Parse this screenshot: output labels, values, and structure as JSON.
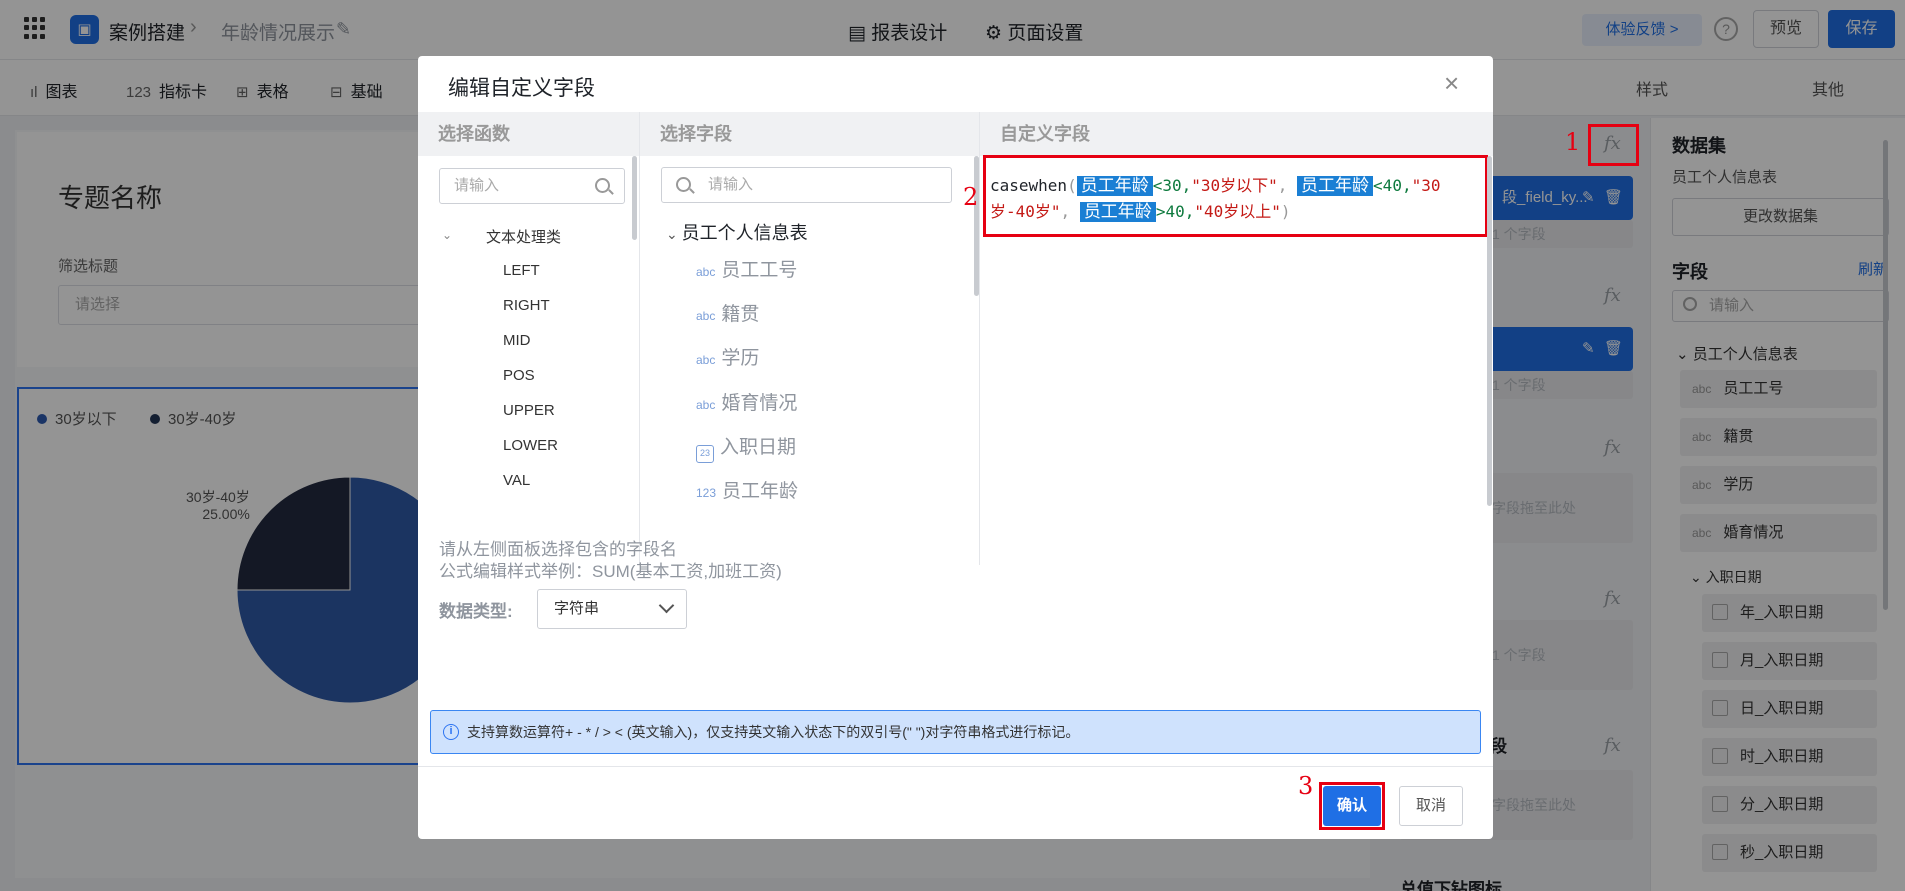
{
  "app": {
    "breadcrumb_project": "案例搭建",
    "breadcrumb_page": "年龄情况展示",
    "tabs": [
      "报表设计",
      "页面设置"
    ],
    "feedback_label": "体验反馈 >",
    "preview_label": "预览",
    "save_label": "保存"
  },
  "toolbar": {
    "items": [
      {
        "icon": "bar-chart-icon",
        "label": "图表"
      },
      {
        "icon": "metric-icon",
        "glyph": "123",
        "label": "指标卡"
      },
      {
        "icon": "table-icon",
        "label": "表格"
      },
      {
        "icon": "basic-icon",
        "label": "基础"
      }
    ],
    "right_tabs": [
      "样式",
      "其他"
    ]
  },
  "canvas": {
    "topic_title": "专题名称",
    "filter_title": "筛选标题",
    "filter_placeholder": "请选择",
    "legend": [
      {
        "label": "30岁以下",
        "color": "#2d5bb0"
      },
      {
        "label": "30岁-40岁",
        "color": "#243657"
      }
    ],
    "pie_label_name": "30岁-40岁",
    "pie_label_pct": "25.00%"
  },
  "chart_data": {
    "type": "pie",
    "categories": [
      "30岁以下",
      "30岁-40岁"
    ],
    "values": [
      75,
      25
    ],
    "colors": [
      "#2f5aa8",
      "#232a40"
    ],
    "labels": [
      "",
      "30岁-40岁 25.00%"
    ],
    "legend_position": "top-left"
  },
  "middle_panel": {
    "chip1_text": "段_field_ky...",
    "hint_one_field": "1 个字段",
    "hint_drag": "字段拖至此处",
    "section_label": "段",
    "section_bottom": "总值下钻图标"
  },
  "right_panel": {
    "dataset_title": "数据集",
    "dataset_name": "员工个人信息表",
    "change_dataset_label": "更改数据集",
    "fields_title": "字段",
    "refresh_label": "刷新",
    "search_placeholder": "请输入",
    "table_name": "员工个人信息表",
    "fields": [
      "员工工号",
      "籍贯",
      "学历",
      "婚育情况"
    ],
    "date_group": "入职日期",
    "date_fields": [
      "年_入职日期",
      "月_入职日期",
      "日_入职日期",
      "时_入职日期",
      "分_入职日期",
      "秒_入职日期"
    ]
  },
  "modal": {
    "title": "编辑自定义字段",
    "col_functions": "选择函数",
    "col_fields": "选择字段",
    "col_custom": "自定义字段",
    "func_search_placeholder": "请输入",
    "field_search_placeholder": "请输入",
    "func_category": "文本处理类",
    "functions": [
      "LEFT",
      "RIGHT",
      "MID",
      "POS",
      "UPPER",
      "LOWER",
      "VAL"
    ],
    "dataset": "员工个人信息表",
    "fields": [
      {
        "type": "abc",
        "name": "员工工号"
      },
      {
        "type": "abc",
        "name": "籍贯"
      },
      {
        "type": "abc",
        "name": "学历"
      },
      {
        "type": "abc",
        "name": "婚育情况"
      },
      {
        "type": "date",
        "name": "入职日期"
      },
      {
        "type": "123",
        "name": "员工年龄"
      }
    ],
    "formula": {
      "fn": "casewhen",
      "open": "(",
      "field": "员工年龄",
      "op1": "<30,",
      "str1": "\"30岁以下\"",
      "op2": "<40,",
      "str2a": "\"30",
      "str2b": "岁-40岁\"",
      "op3": ">40,",
      "str3": "\"40岁以上\"",
      "close": ")"
    },
    "hint_line1": "请从左侧面板选择包含的字段名",
    "hint_line2": "公式编辑样式举例：SUM(基本工资,加班工资)",
    "dtype_label": "数据类型:",
    "dtype_value": "字符串",
    "info_text": "支持算数运算符+ - * / > < (英文输入)，仅支持英文输入状态下的双引号(\" \")对字符串格式进行标记。",
    "confirm_label": "确认",
    "cancel_label": "取消"
  },
  "annotations": [
    "1",
    "2",
    "3"
  ]
}
